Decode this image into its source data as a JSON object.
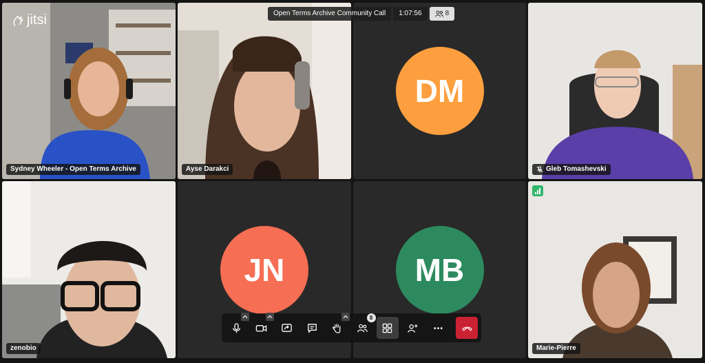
{
  "app": {
    "logo_text": "jitsi"
  },
  "meeting": {
    "title": "Open Terms Archive Community Call",
    "duration": "1:07:56",
    "participant_count": "8"
  },
  "tiles": [
    {
      "name": "Sydney Wheeler - Open Terms Archive",
      "dominant": true
    },
    {
      "name": "Ayse Darakci"
    },
    {
      "initials": "DM",
      "avatar_color": "#fd9f3f"
    },
    {
      "name": "Gleb Tomashevski",
      "muted": true
    },
    {
      "name": "zenobio"
    },
    {
      "initials": "JN",
      "avatar_color": "#f66e53"
    },
    {
      "initials": "MB",
      "avatar_color": "#2d8a5f"
    },
    {
      "name": "Marie-Pierre",
      "connection": "good"
    }
  ],
  "toolbar": {
    "buttons": [
      {
        "icon": "microphone-icon",
        "has_menu": true
      },
      {
        "icon": "camera-icon",
        "has_menu": true
      },
      {
        "icon": "screen-share-icon"
      },
      {
        "icon": "chat-icon"
      },
      {
        "icon": "raise-hand-icon",
        "has_menu": true
      },
      {
        "icon": "participants-icon",
        "badge": "8"
      },
      {
        "icon": "tile-view-icon",
        "toggled": true
      },
      {
        "icon": "invite-icon"
      },
      {
        "icon": "more-icon"
      },
      {
        "icon": "hangup-icon"
      }
    ]
  },
  "colors": {
    "accent": "#4687ed",
    "hangup": "#cb2233",
    "signal": "#31b76a"
  }
}
